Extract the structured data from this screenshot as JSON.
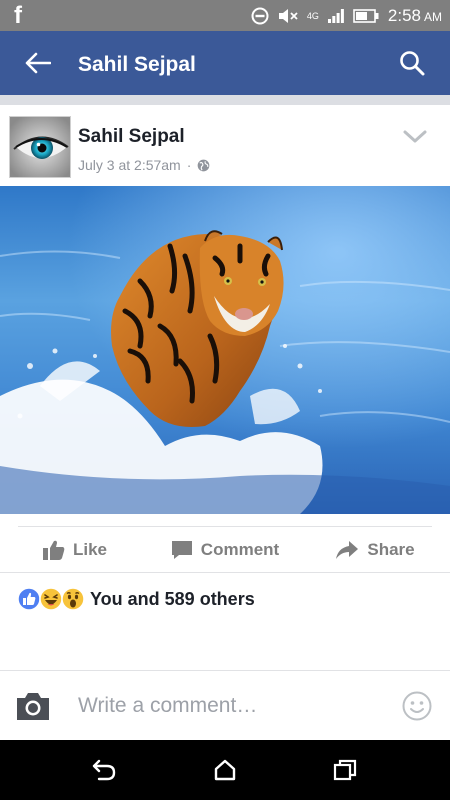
{
  "status_bar": {
    "app_icon": "facebook-f-icon",
    "time": "2:58",
    "ampm": "AM",
    "signal_label": "4G",
    "icons": [
      "do-not-disturb-icon",
      "mute-icon",
      "signal-icon",
      "battery-icon"
    ]
  },
  "app_bar": {
    "title": "Sahil Sejpal",
    "back_icon": "back-arrow-icon",
    "search_icon": "search-icon",
    "background_color": "#3b5998"
  },
  "post": {
    "author": "Sahil Sejpal",
    "timestamp": "July 3 at 2:57am",
    "separator": "·",
    "privacy_icon": "globe-icon",
    "menu_icon": "chevron-down-icon",
    "avatar_icon": "eye-avatar",
    "photo": "tiger-running-in-water-photo"
  },
  "actions": {
    "like": "Like",
    "comment": "Comment",
    "share": "Share"
  },
  "reactions": {
    "icons": [
      "like-reaction-icon",
      "haha-reaction-icon",
      "wow-reaction-icon"
    ],
    "summary": "You and 589 others"
  },
  "comment_box": {
    "placeholder": "Write a comment…",
    "camera_icon": "camera-icon",
    "emoji_icon": "smiley-icon"
  },
  "nav_bar": {
    "buttons": [
      "nav-back-icon",
      "nav-home-icon",
      "nav-recents-icon"
    ]
  }
}
